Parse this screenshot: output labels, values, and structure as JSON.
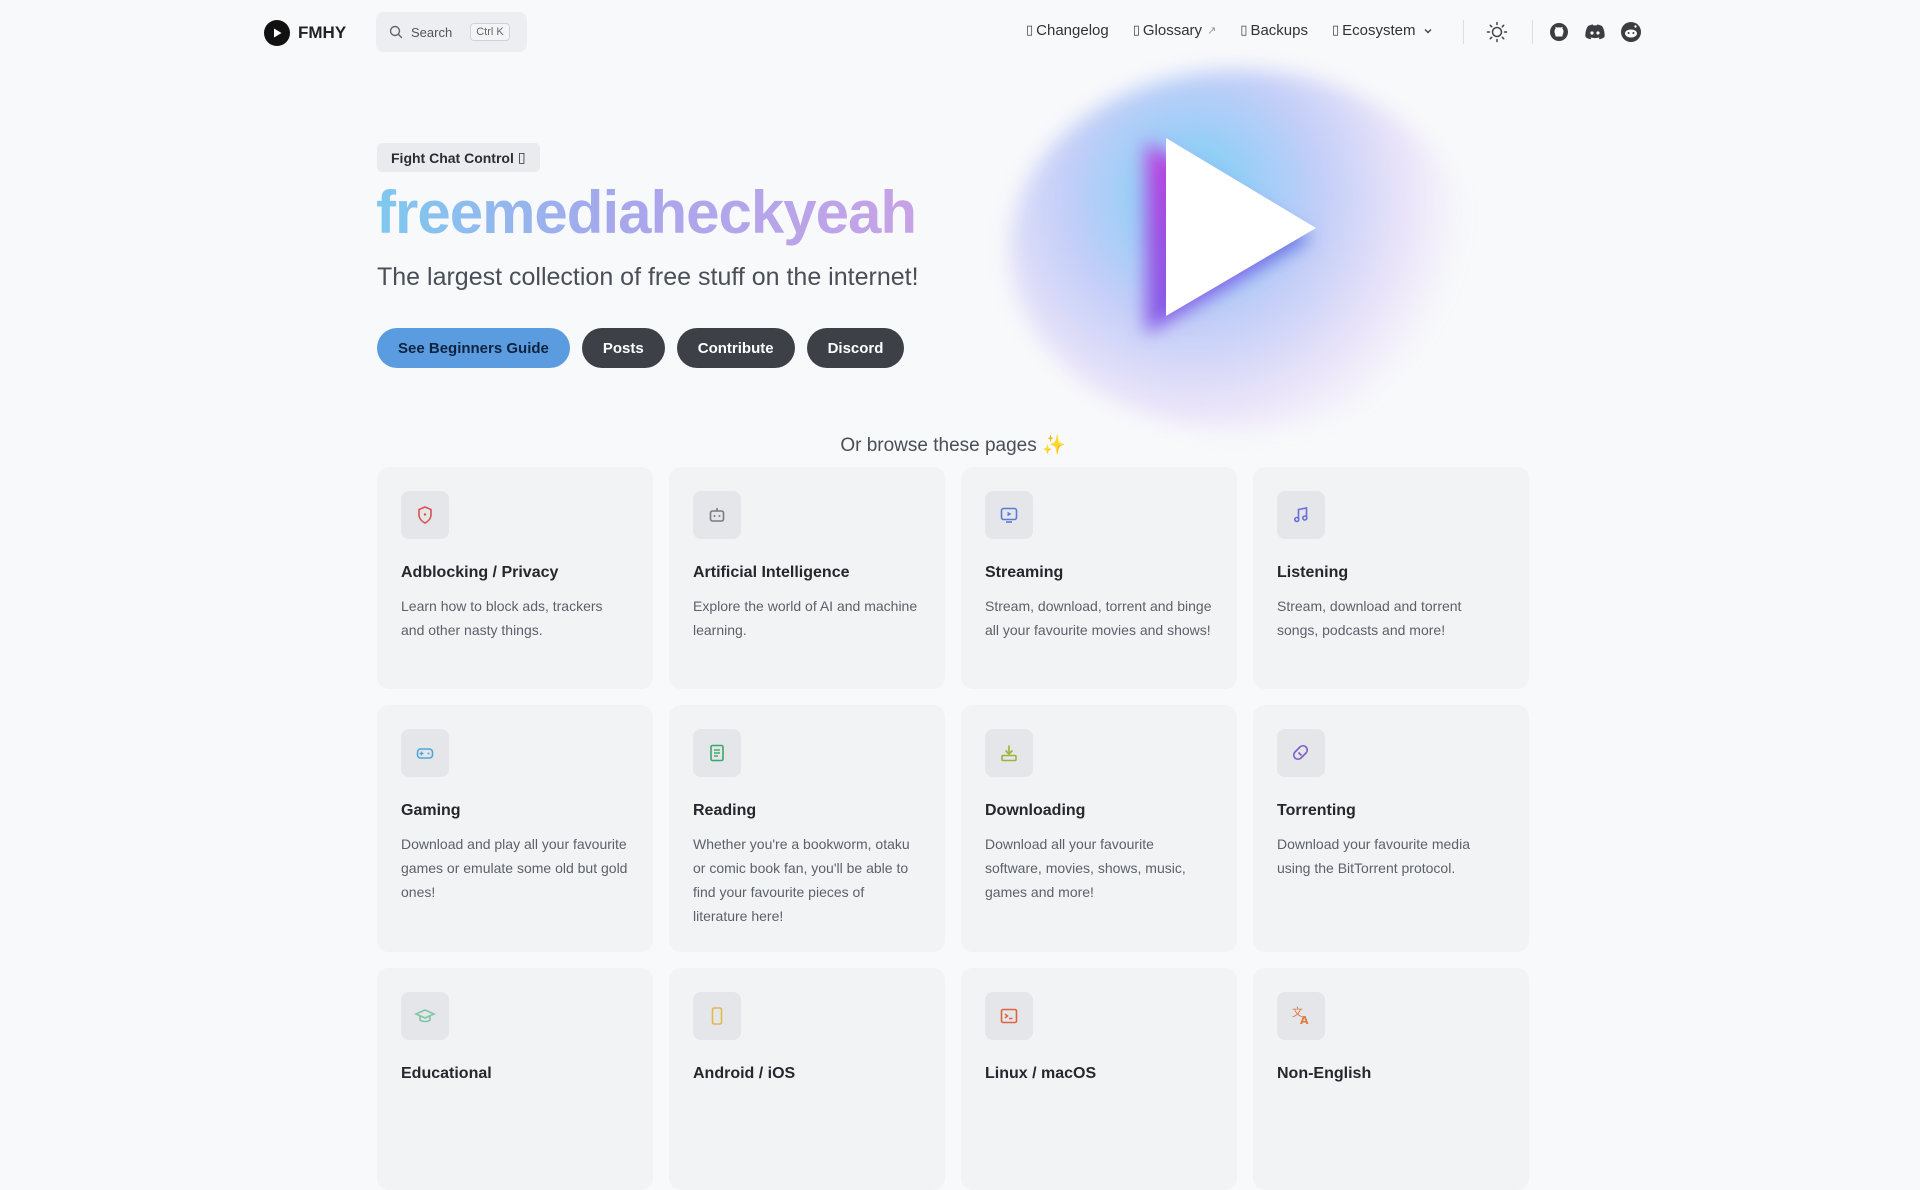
{
  "nav": {
    "brand": "FMHY",
    "search_label": "Search",
    "search_shortcut": "Ctrl K",
    "links": [
      {
        "label": "Changelog",
        "icon": "changelog-icon"
      },
      {
        "label": "Glossary",
        "icon": "glossary-icon",
        "external": true
      },
      {
        "label": "Backups",
        "icon": "backups-icon"
      },
      {
        "label": "Ecosystem",
        "icon": "ecosystem-icon",
        "dropdown": true
      }
    ],
    "external_arrow": "↗"
  },
  "hero": {
    "badge": "Fight Chat Control",
    "title": "freemediaheckyeah",
    "subtitle": "The largest collection of free stuff on the internet!",
    "buttons": {
      "guide": "See Beginners Guide",
      "posts": "Posts",
      "contribute": "Contribute",
      "discord": "Discord"
    }
  },
  "browse": {
    "title": "Or browse these pages ✨",
    "cards": [
      {
        "title": "Adblocking / Privacy",
        "desc": "Learn how to block ads, trackers and other nasty things.",
        "icon": "shield-icon",
        "color": "#d9534f"
      },
      {
        "title": "Artificial Intelligence",
        "desc": "Explore the world of AI and machine learning.",
        "icon": "robot-icon",
        "color": "#777b82"
      },
      {
        "title": "Streaming",
        "desc": "Stream, download, torrent and binge all your favourite movies and shows!",
        "icon": "tv-play-icon",
        "color": "#5b7bd5"
      },
      {
        "title": "Listening",
        "desc": "Stream, download and torrent songs, podcasts and more!",
        "icon": "music-note-icon",
        "color": "#6a6fd8"
      },
      {
        "title": "Gaming",
        "desc": "Download and play all your favourite games or emulate some old but gold ones!",
        "icon": "gamepad-icon",
        "color": "#4fa6d8"
      },
      {
        "title": "Reading",
        "desc": "Whether you're a bookworm, otaku or comic book fan, you'll be able to find your favourite pieces of literature here!",
        "icon": "book-icon",
        "color": "#3aa86b"
      },
      {
        "title": "Downloading",
        "desc": "Download all your favourite software, movies, shows, music, games and more!",
        "icon": "download-icon",
        "color": "#9bb33a"
      },
      {
        "title": "Torrenting",
        "desc": "Download your favourite media using the BitTorrent protocol.",
        "icon": "magnet-icon",
        "color": "#7a5fc9"
      },
      {
        "title": "Educational",
        "desc": "",
        "icon": "graduation-cap-icon",
        "color": "#7fc7a3"
      },
      {
        "title": "Android / iOS",
        "desc": "",
        "icon": "phone-icon",
        "color": "#e1b84a"
      },
      {
        "title": "Linux / macOS",
        "desc": "",
        "icon": "terminal-icon",
        "color": "#e0643f"
      },
      {
        "title": "Non-English",
        "desc": "",
        "icon": "translate-icon",
        "color": "#e07b3f"
      }
    ]
  }
}
